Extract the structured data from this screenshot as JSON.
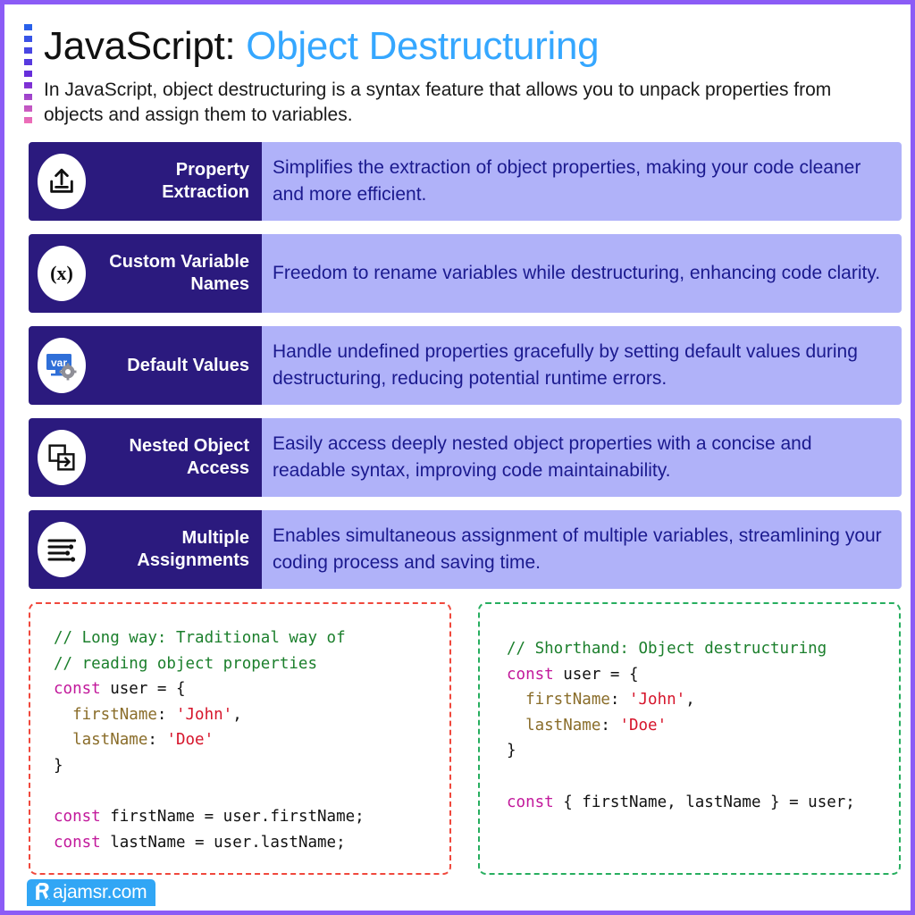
{
  "theme": {
    "page_border": "#8b5cf6",
    "title_primary": "#111111",
    "title_accent": "#35a7ff",
    "feature_label_bg": "#2b1a7e",
    "feature_desc_bg": "#b0b2f9",
    "feature_desc_text": "#1b1a8e",
    "code_left_border": "#f0483c",
    "code_right_border": "#27ae5f",
    "watermark_bg": "#31a6f5"
  },
  "header": {
    "title_primary": "JavaScript:",
    "title_accent": "Object Destructuring",
    "subtitle": "In JavaScript, object destructuring is a syntax feature that allows you to unpack properties from objects and assign them to variables."
  },
  "features": [
    {
      "icon": "upload-icon",
      "title": "Property Extraction",
      "title_line1": "Property",
      "title_line2": "Extraction",
      "description": "Simplifies the extraction of object properties, making your code cleaner and more efficient."
    },
    {
      "icon": "variable-x-icon",
      "title": "Custom Variable Names",
      "title_line1": "Custom",
      "title_line2": "Variable Names",
      "description": "Freedom to rename variables while destructuring, enhancing code clarity."
    },
    {
      "icon": "var-gear-icon",
      "title": "Default Values",
      "title_line1": "Default Values",
      "title_line2": "",
      "icon_label": "var",
      "description": "Handle undefined properties gracefully by setting default values during destructuring, reducing potential runtime errors."
    },
    {
      "icon": "nested-windows-icon",
      "title": "Nested Object Access",
      "title_line1": "Nested",
      "title_line2": "Object Access",
      "description": "Easily access deeply nested object properties with a concise and readable syntax, improving code maintainability."
    },
    {
      "icon": "sliders-list-icon",
      "title": "Multiple Assignments",
      "title_line1": "Multiple",
      "title_line2": "Assignments",
      "description": "Enables simultaneous assignment of multiple variables, streamlining your coding process and saving time."
    }
  ],
  "code_blocks": {
    "left": {
      "label": "Long way",
      "lines": [
        [
          {
            "t": "// Long way: Traditional way of",
            "c": "cm"
          }
        ],
        [
          {
            "t": "// reading object properties",
            "c": "cm"
          }
        ],
        [
          {
            "t": "const",
            "c": "kw"
          },
          {
            "t": " user = {",
            "c": "pn"
          }
        ],
        [
          {
            "t": "  ",
            "c": "pn"
          },
          {
            "t": "firstName",
            "c": "pr"
          },
          {
            "t": ": ",
            "c": "pn"
          },
          {
            "t": "'John'",
            "c": "st"
          },
          {
            "t": ",",
            "c": "pn"
          }
        ],
        [
          {
            "t": "  ",
            "c": "pn"
          },
          {
            "t": "lastName",
            "c": "pr"
          },
          {
            "t": ": ",
            "c": "pn"
          },
          {
            "t": "'Doe'",
            "c": "st"
          }
        ],
        [
          {
            "t": "}",
            "c": "pn"
          }
        ],
        [
          {
            "t": "",
            "c": "pn"
          }
        ],
        [
          {
            "t": "const",
            "c": "kw"
          },
          {
            "t": " firstName = user.firstName;",
            "c": "pn"
          }
        ],
        [
          {
            "t": "const",
            "c": "kw"
          },
          {
            "t": " lastName = user.lastName;",
            "c": "pn"
          }
        ]
      ]
    },
    "right": {
      "label": "Shorthand",
      "lines": [
        [
          {
            "t": "// Shorthand: Object destructuring",
            "c": "cm"
          }
        ],
        [
          {
            "t": "const",
            "c": "kw"
          },
          {
            "t": " user = {",
            "c": "pn"
          }
        ],
        [
          {
            "t": "  ",
            "c": "pn"
          },
          {
            "t": "firstName",
            "c": "pr"
          },
          {
            "t": ": ",
            "c": "pn"
          },
          {
            "t": "'John'",
            "c": "st"
          },
          {
            "t": ",",
            "c": "pn"
          }
        ],
        [
          {
            "t": "  ",
            "c": "pn"
          },
          {
            "t": "lastName",
            "c": "pr"
          },
          {
            "t": ": ",
            "c": "pn"
          },
          {
            "t": "'Doe'",
            "c": "st"
          }
        ],
        [
          {
            "t": "}",
            "c": "pn"
          }
        ],
        [
          {
            "t": "",
            "c": "pn"
          }
        ],
        [
          {
            "t": "const",
            "c": "kw"
          },
          {
            "t": " { firstName, lastName } = user;",
            "c": "pn"
          }
        ]
      ]
    }
  },
  "watermark": {
    "text": "ajamsr.com",
    "logo": "rajamsr-logo-icon"
  }
}
